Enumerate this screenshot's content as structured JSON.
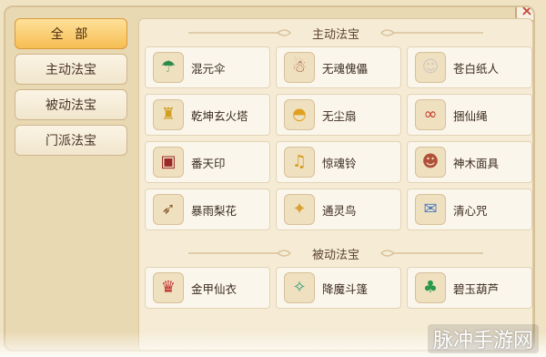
{
  "sidebar": {
    "items": [
      {
        "label": "全 部",
        "active": true
      },
      {
        "label": "主动法宝",
        "active": false
      },
      {
        "label": "被动法宝",
        "active": false
      },
      {
        "label": "门派法宝",
        "active": false
      }
    ]
  },
  "sections": {
    "active": {
      "title": "主动法宝",
      "items": [
        {
          "name": "混元伞",
          "icon": "umbrella-icon",
          "glyph": "☂",
          "color": "#2c8a4a"
        },
        {
          "name": "无魂傀儡",
          "icon": "puppet-icon",
          "glyph": "☃",
          "color": "#a0522d"
        },
        {
          "name": "苍白纸人",
          "icon": "paper-doll-icon",
          "glyph": "☺",
          "color": "#d0c8c0"
        },
        {
          "name": "乾坤玄火塔",
          "icon": "pagoda-icon",
          "glyph": "♜",
          "color": "#d2a020"
        },
        {
          "name": "无尘扇",
          "icon": "fan-icon",
          "glyph": "◓",
          "color": "#e0a020"
        },
        {
          "name": "捆仙绳",
          "icon": "rope-icon",
          "glyph": "∞",
          "color": "#c43a2a"
        },
        {
          "name": "番天印",
          "icon": "seal-icon",
          "glyph": "▣",
          "color": "#9a2a2a"
        },
        {
          "name": "惊魂铃",
          "icon": "bell-icon",
          "glyph": "♫",
          "color": "#d49a20"
        },
        {
          "name": "神木面具",
          "icon": "mask-icon",
          "glyph": "☻",
          "color": "#b0503a"
        },
        {
          "name": "暴雨梨花",
          "icon": "crossbow-icon",
          "glyph": "➶",
          "color": "#8a5a2a"
        },
        {
          "name": "通灵鸟",
          "icon": "bird-icon",
          "glyph": "✦",
          "color": "#d8a030"
        },
        {
          "name": "清心咒",
          "icon": "scroll-icon",
          "glyph": "✉",
          "color": "#4a7ac0"
        }
      ]
    },
    "passive": {
      "title": "被动法宝",
      "items": [
        {
          "name": "金甲仙衣",
          "icon": "armor-icon",
          "glyph": "♛",
          "color": "#c03030"
        },
        {
          "name": "降魔斗篷",
          "icon": "cloak-icon",
          "glyph": "✧",
          "color": "#3aa080"
        },
        {
          "name": "碧玉葫芦",
          "icon": "gourd-icon",
          "glyph": "♣",
          "color": "#2a9a4a"
        }
      ]
    }
  },
  "watermark": "脉冲手游网",
  "close_glyph": "×"
}
